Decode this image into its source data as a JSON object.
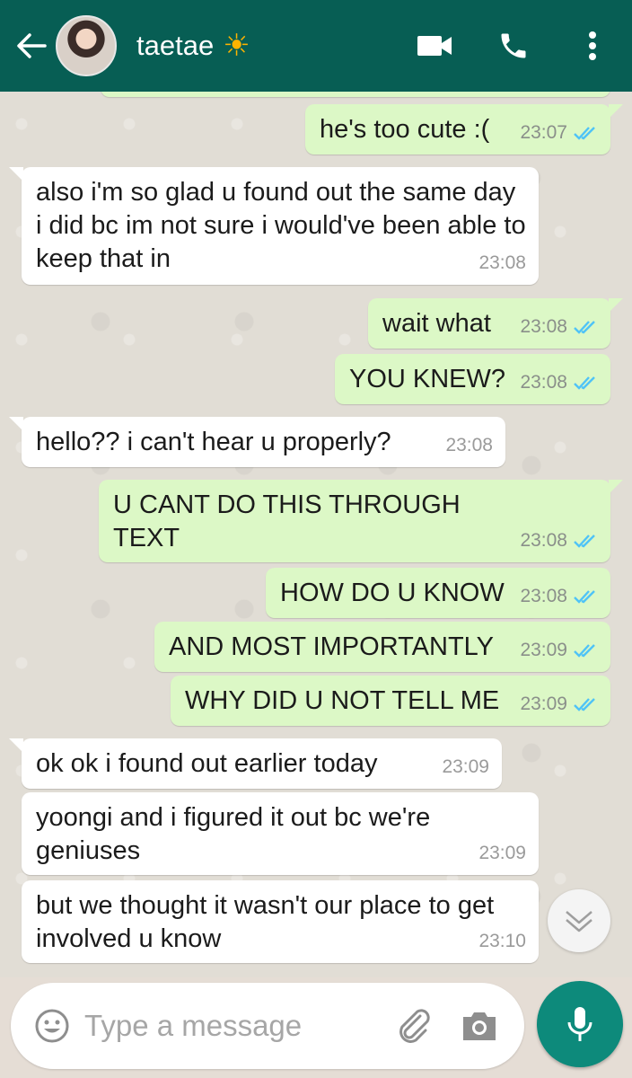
{
  "header": {
    "contact_name": "taetae",
    "contact_emoji": "☀",
    "icons": [
      "back-arrow-icon",
      "video-call-icon",
      "phone-icon",
      "more-vertical-icon"
    ],
    "color": "#075e54"
  },
  "messages": [
    {
      "text": "he's too cute :(",
      "time": "23:07",
      "direction": "outgoing",
      "status": "read"
    },
    {
      "text": "also i'm so glad u found out the same day i did bc im not sure i would've been able to keep that in",
      "time": "23:08",
      "direction": "incoming"
    },
    {
      "text": "wait what",
      "time": "23:08",
      "direction": "outgoing",
      "status": "read"
    },
    {
      "text": "YOU KNEW?",
      "time": "23:08",
      "direction": "outgoing",
      "status": "read"
    },
    {
      "text": "hello?? i can't hear u properly?",
      "time": "23:08",
      "direction": "incoming"
    },
    {
      "text": "U CANT DO THIS THROUGH TEXT",
      "time": "23:08",
      "direction": "outgoing",
      "status": "read"
    },
    {
      "text": "HOW DO U KNOW",
      "time": "23:08",
      "direction": "outgoing",
      "status": "read"
    },
    {
      "text": "AND MOST IMPORTANTLY",
      "time": "23:09",
      "direction": "outgoing",
      "status": "read"
    },
    {
      "text": "WHY DID U NOT TELL ME",
      "time": "23:09",
      "direction": "outgoing",
      "status": "read"
    },
    {
      "text": "ok ok i found out earlier today",
      "time": "23:09",
      "direction": "incoming"
    },
    {
      "text": "yoongi and i figured it out bc we're geniuses",
      "time": "23:09",
      "direction": "incoming"
    },
    {
      "text": "but we thought it wasn't our place to get involved u know",
      "time": "23:10",
      "direction": "incoming"
    }
  ],
  "composer": {
    "placeholder": "Type a message",
    "icons": [
      "emoji-icon",
      "attach-icon",
      "camera-icon",
      "microphone-icon"
    ]
  },
  "colors": {
    "outgoing_bubble": "#dcf8c6",
    "incoming_bubble": "#ffffff",
    "read_tick": "#4fc3f7",
    "mic_button": "#0d8a7b"
  }
}
